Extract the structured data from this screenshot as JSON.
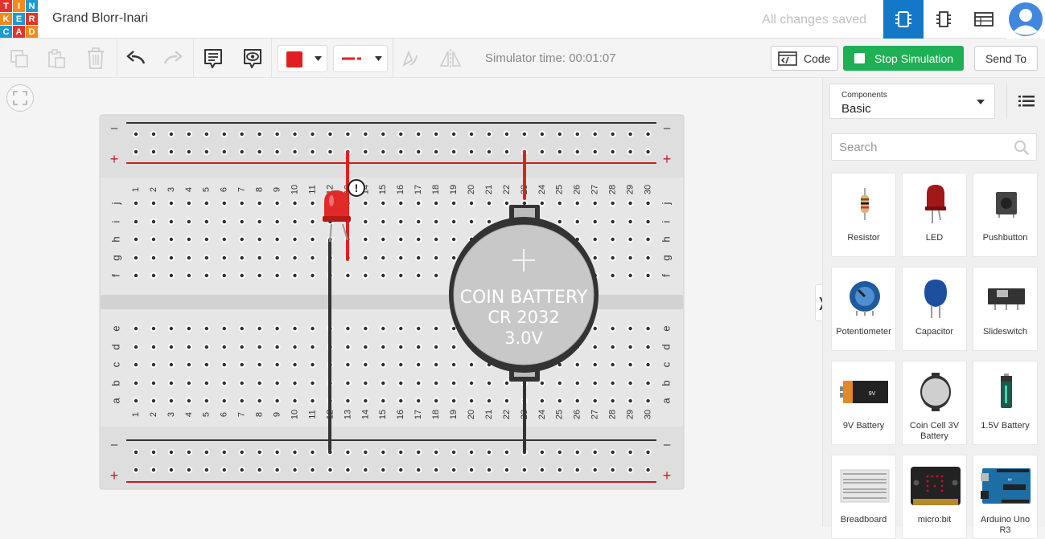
{
  "header": {
    "logo_letters": [
      "T",
      "I",
      "N",
      "K",
      "E",
      "R",
      "C",
      "A",
      "D"
    ],
    "logo_colors": [
      "#e2352a",
      "#f28b1c",
      "#1c9ad6",
      "#f28b1c",
      "#1c9ad6",
      "#e2352a",
      "#1c9ad6",
      "#e2352a",
      "#f28b1c"
    ],
    "project_title": "Grand Blorr-Inari",
    "save_status": "All changes saved",
    "accent": "#1478c8"
  },
  "toolbar": {
    "simulator_time": "Simulator time: 00:01:07",
    "code_label": "Code",
    "stop_label": "Stop Simulation",
    "send_label": "Send To",
    "wire_color": "#e02020",
    "stop_color": "#1db054"
  },
  "breadboard": {
    "columns": [
      "1",
      "2",
      "3",
      "4",
      "5",
      "6",
      "7",
      "8",
      "9",
      "10",
      "11",
      "12",
      "13",
      "14",
      "15",
      "16",
      "17",
      "18",
      "19",
      "20",
      "21",
      "22",
      "23",
      "24",
      "25",
      "26",
      "27",
      "28",
      "29",
      "30"
    ],
    "upper_rows": [
      "j",
      "i",
      "h",
      "g",
      "f"
    ],
    "lower_rows": [
      "e",
      "d",
      "c",
      "b",
      "a"
    ],
    "rail_minus": "–",
    "rail_plus": "+"
  },
  "battery": {
    "line1": "COIN BATTERY",
    "line2": "CR 2032",
    "line3": "3.0V",
    "plus": "+"
  },
  "panel": {
    "select_label": "Components",
    "select_value": "Basic",
    "search_placeholder": "Search",
    "components": [
      {
        "name": "Resistor",
        "icon": "resistor-icon"
      },
      {
        "name": "LED",
        "icon": "led-icon"
      },
      {
        "name": "Pushbutton",
        "icon": "pushbutton-icon"
      },
      {
        "name": "Potentiometer",
        "icon": "potentiometer-icon"
      },
      {
        "name": "Capacitor",
        "icon": "capacitor-icon"
      },
      {
        "name": "Slideswitch",
        "icon": "slideswitch-icon"
      },
      {
        "name": "9V Battery",
        "icon": "9v-battery-icon"
      },
      {
        "name": "Coin Cell 3V Battery",
        "icon": "coin-cell-icon"
      },
      {
        "name": "1.5V Battery",
        "icon": "aa-battery-icon"
      },
      {
        "name": "Breadboard",
        "icon": "breadboard-icon"
      },
      {
        "name": "micro:bit",
        "icon": "microbit-icon"
      },
      {
        "name": "Arduino Uno R3",
        "icon": "arduino-icon"
      }
    ]
  }
}
